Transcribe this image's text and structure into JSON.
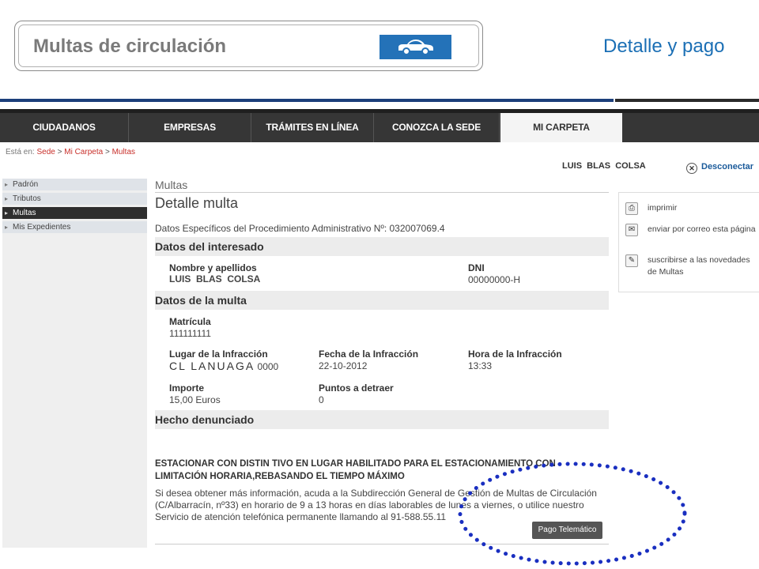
{
  "slide": {
    "title": "Multas de circulación",
    "subtitle": "Detalle y pago",
    "car_icon": "car-icon"
  },
  "nav": {
    "items": [
      {
        "label": "CIUDADANOS"
      },
      {
        "label": "EMPRESAS"
      },
      {
        "label": "TRÁMITES EN LÍNEA"
      },
      {
        "label": "CONOZCA LA SEDE"
      },
      {
        "label": "MI CARPETA"
      }
    ],
    "active_index": 4
  },
  "breadcrumb": {
    "prefix": "Está en:",
    "items": [
      "Sede",
      "Mi Carpeta",
      "Multas"
    ],
    "separator": ">"
  },
  "user": {
    "name": "LUIS  BLAS  COLSA",
    "disconnect_label": "Desconectar"
  },
  "sidebar": {
    "items": [
      {
        "label": "Padrón"
      },
      {
        "label": "Tributos"
      },
      {
        "label": "Multas"
      },
      {
        "label": "Mis Expedientes"
      }
    ],
    "active_index": 2
  },
  "main": {
    "section": "Multas",
    "title": "Detalle multa",
    "procedure": "Datos Específicos del Procedimiento Administrativo Nº: 032007069.4",
    "interesado": {
      "heading": "Datos del interesado",
      "name_label": "Nombre y apellidos",
      "name_value": "LUIS  BLAS  COLSA",
      "dni_label": "DNI",
      "dni_value": "00000000",
      "dni_suffix": "-H"
    },
    "multa": {
      "heading": "Datos de la multa",
      "plate_label": "Matrícula",
      "plate_value": "111111111",
      "place_label": "Lugar de la Infracción",
      "place_value": "CL LANUAGA",
      "place_number": "0000",
      "date_label": "Fecha de la Infracción",
      "date_value": "22-10-2012",
      "time_label": "Hora de la Infracción",
      "time_value": "13:33",
      "amount_label": "Importe",
      "amount_value": "15,00 Euros",
      "points_label": "Puntos a detraer",
      "points_value": "0"
    },
    "hecho": {
      "heading": "Hecho denunciado",
      "offense": "ESTACIONAR CON DISTIN TIVO EN LUGAR HABILITADO PARA EL ESTACIONAMIENTO CON LIMITACIÓN HORARIA,REBASANDO EL TIEMPO MÁXIMO",
      "info": "Si desea obtener más información, acuda a la Subdirección General de Gestión de Multas de Circulación (C/Albarracín, nº33) en horario de 9 a 13 horas en días laborables de lunes a viernes, o utilice nuestro Servicio de atención telefónica permanente llamando al 91-588.55.11"
    },
    "pay_button": "Pago Telemático"
  },
  "right_panel": {
    "items": [
      {
        "icon": "printer-icon",
        "label": "imprimir"
      },
      {
        "icon": "envelope-icon",
        "label": "enviar por correo esta página"
      },
      {
        "icon": "subscribe-icon",
        "label": "suscribirse a las novedades de Multas"
      }
    ]
  },
  "colors": {
    "accent_blue": "#1b6fb5",
    "nav_dark": "#363636",
    "breadcrumb_red": "#c8302b",
    "highlight_ellipse": "#1a2fc0"
  }
}
